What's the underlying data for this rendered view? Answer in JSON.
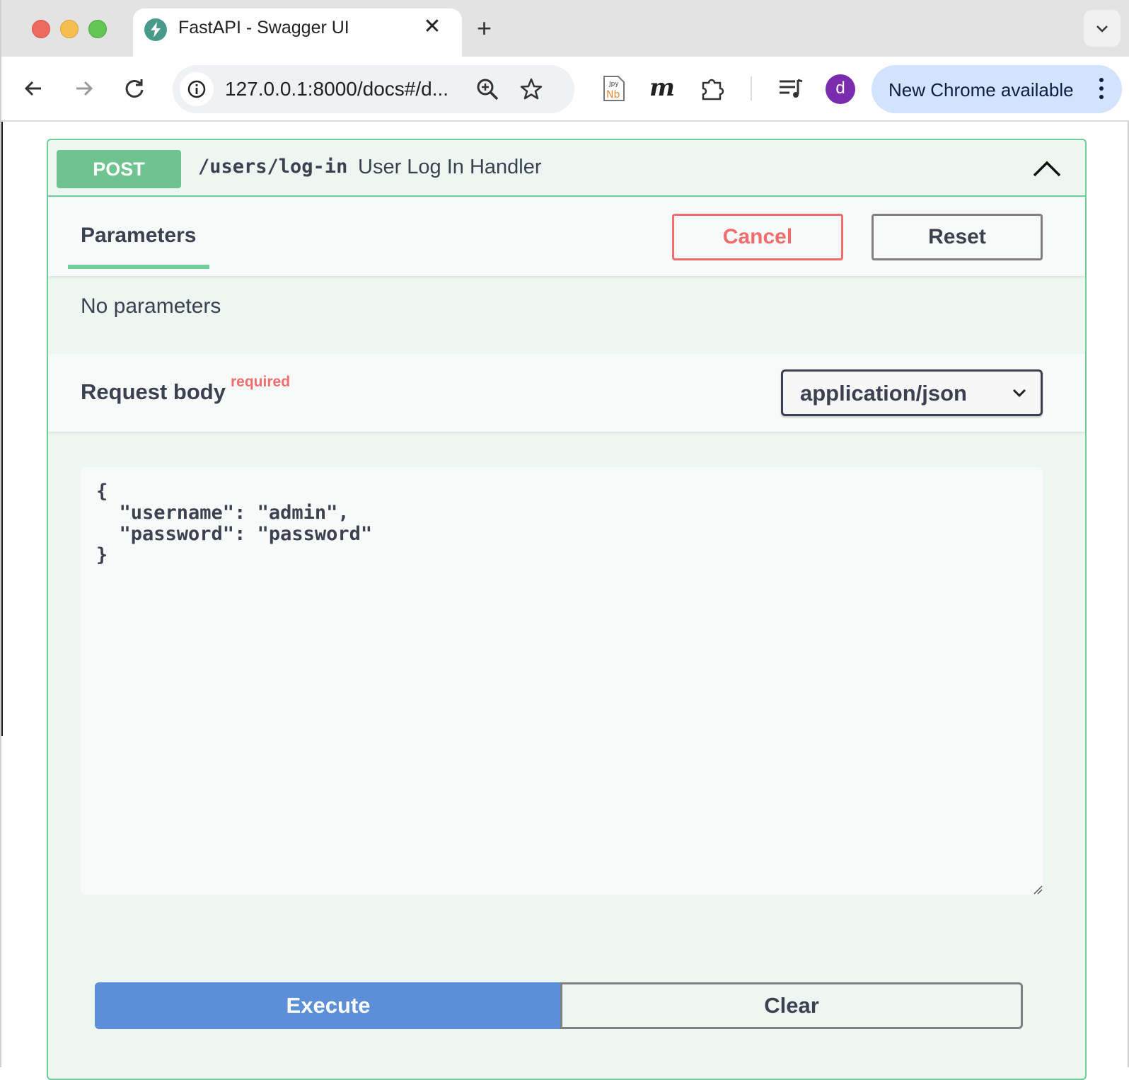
{
  "browser": {
    "tab_title": "FastAPI - Swagger UI",
    "url": "127.0.0.1:8000/docs#/d...",
    "profile_initial": "d",
    "update_label": "New Chrome available"
  },
  "icons": {
    "back": "arrow-left-icon",
    "forward": "arrow-right-icon",
    "reload": "reload-icon",
    "site_info": "info-icon",
    "zoom": "zoom-icon",
    "bookmark": "star-icon",
    "jupyter": "jupyter-nb-icon",
    "mark": "m-icon",
    "extensions": "puzzle-icon",
    "media": "media-queue-icon"
  },
  "operation": {
    "method": "POST",
    "path": "/users/log-in",
    "summary": "User Log In Handler"
  },
  "parameters": {
    "tab_label": "Parameters",
    "cancel_label": "Cancel",
    "reset_label": "Reset",
    "empty_text": "No parameters"
  },
  "request_body": {
    "title": "Request body",
    "required_label": "required",
    "content_type": "application/json",
    "value": "{\n  \"username\": \"admin\",\n  \"password\": \"password\"\n}"
  },
  "actions": {
    "execute_label": "Execute",
    "clear_label": "Clear"
  },
  "colors": {
    "post_green": "#6ec38f",
    "border_green": "#6fcd9b",
    "cancel_red": "#ef6d6d",
    "execute_blue": "#5d8fd9",
    "avatar_purple": "#7b2cae",
    "update_chip": "#d3e3fd"
  }
}
